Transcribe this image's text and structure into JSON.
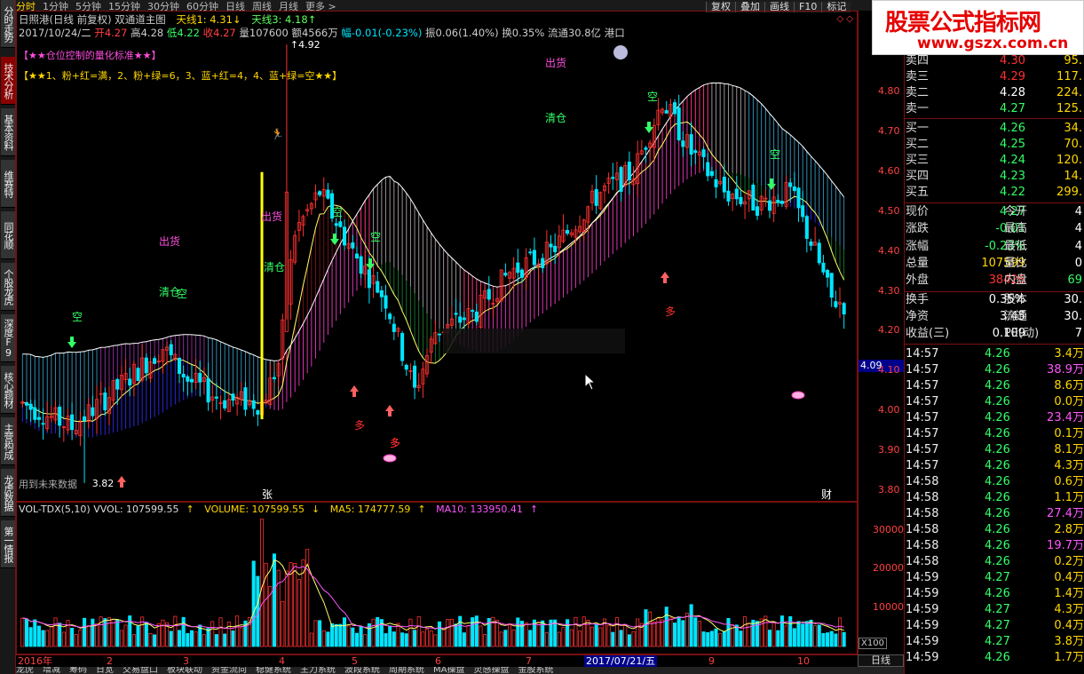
{
  "top_tabs": [
    "分时",
    "1分钟",
    "5分钟",
    "15分钟",
    "30分钟",
    "60分钟",
    "日线",
    "周线",
    "月线",
    "更多 >"
  ],
  "top_buttons": [
    "复权",
    "叠加",
    "画线",
    "F10",
    "标记"
  ],
  "left_tabs": [
    "分时走势",
    "技术分析",
    "基本资料",
    "维赛特10",
    "同花顺",
    "个股龙虎",
    "深度F9",
    "核心题材",
    "主营构成",
    "龙虎数据",
    "第一情报"
  ],
  "header": {
    "line1_title": "日照港(日线 前复权) 双通道主图",
    "line1_tian1": "天线1: 4.31",
    "line1_tian3": "天线3: 4.18",
    "line2_date": "2017/10/24/二",
    "line2_open": "开4.27",
    "line2_high": "高4.28",
    "line2_low": "低4.22",
    "line2_close": "收4.27",
    "line2_vol": "量107600",
    "line2_amt": "额4566万",
    "line2_chg": "幅-0.01(-0.23%)",
    "line2_amp": "振0.06(1.40%)",
    "line2_turn": "换0.35%",
    "line2_float": "流通30.8亿",
    "line2_market": "港口",
    "line3": "【★★仓位控制的量化标准★★】",
    "line4": "【★★1、粉+红=满，2、粉+绿=6，3、蓝+红=4，4、蓝+绿=空★★】"
  },
  "price_axis": [
    "4.80",
    "4.70",
    "4.60",
    "4.50",
    "4.40",
    "4.30",
    "4.20",
    "4.10",
    "4.00",
    "3.90",
    "3.80"
  ],
  "current_price_tag": "4.09",
  "chart_annotations": {
    "high_label": "4.92",
    "low_label": "3.82",
    "future_note": "用到未来数据",
    "signals": [
      "空",
      "出货",
      "清仓",
      "空",
      "出货",
      "清仓",
      "空",
      "空",
      "多",
      "多",
      "多",
      "出货",
      "清仓",
      "空",
      "空",
      "多",
      "张",
      "财"
    ]
  },
  "volume": {
    "header_name": "VOL-TDX(5,10)",
    "vvol": "VVOL: 107599.55",
    "volume": "VOLUME: 107599.55",
    "ma5": "MA5: 174777.59",
    "ma10": "MA10: 133950.41",
    "axis": [
      "30000",
      "20000",
      "10000"
    ],
    "scale": "X100"
  },
  "date_axis": {
    "labels": [
      "2016年",
      "2",
      "3",
      "4",
      "5",
      "6",
      "7",
      "9",
      "10"
    ],
    "selected_date": "2017/07/21/五",
    "period_button": "日线"
  },
  "bottom_tabs": [
    "龙虎",
    "增减",
    "筹码",
    "日宽",
    "交易盘口",
    "板块联动",
    "资金流向",
    "稳健系统",
    "主力系统",
    "波段系统",
    "周期系统",
    "MA操盘",
    "灵感操盘",
    "金股系统"
  ],
  "logo": {
    "title": "股票公式指标网",
    "url": "www.gszx.com.cn"
  },
  "orderbook": {
    "sells": [
      {
        "label": "卖四",
        "price": "4.30",
        "vol": "95."
      },
      {
        "label": "卖三",
        "price": "4.29",
        "vol": "117."
      },
      {
        "label": "卖二",
        "price": "4.28",
        "vol": "224."
      },
      {
        "label": "卖一",
        "price": "4.27",
        "vol": "125."
      }
    ],
    "buys": [
      {
        "label": "买一",
        "price": "4.26",
        "vol": "34."
      },
      {
        "label": "买二",
        "price": "4.25",
        "vol": "70."
      },
      {
        "label": "买三",
        "price": "4.24",
        "vol": "120."
      },
      {
        "label": "买四",
        "price": "4.23",
        "vol": "14."
      },
      {
        "label": "买五",
        "price": "4.22",
        "vol": "299."
      }
    ]
  },
  "quote": [
    {
      "k1": "现价",
      "v1": "4.27",
      "k2": "今开",
      "v2": "4"
    },
    {
      "k1": "涨跌",
      "v1": "-0.01",
      "k2": "最高",
      "v2": "4"
    },
    {
      "k1": "涨幅",
      "v1": "-0.23%",
      "k2": "最低",
      "v2": "4"
    },
    {
      "k1": "总量",
      "v1": "107599",
      "k2": "量比",
      "v2": "0"
    },
    {
      "k1": "外盘",
      "v1": "38426",
      "k2": "内盘",
      "v2": "69"
    },
    {
      "k1": "换手",
      "v1": "0.35%",
      "k2": "股本",
      "v2": "30."
    },
    {
      "k1": "净资",
      "v1": "3.45",
      "k2": "流通",
      "v2": "30."
    },
    {
      "k1": "收益(三)",
      "v1": "0.109",
      "k2": "PE(动)",
      "v2": "7"
    }
  ],
  "ticks": [
    {
      "t": "14:57",
      "p": "4.26",
      "v": "3.4万"
    },
    {
      "t": "14:57",
      "p": "4.26",
      "v": "38.9万"
    },
    {
      "t": "14:57",
      "p": "4.26",
      "v": "8.6万"
    },
    {
      "t": "14:57",
      "p": "4.26",
      "v": "0.0万"
    },
    {
      "t": "14:57",
      "p": "4.26",
      "v": "23.4万"
    },
    {
      "t": "14:57",
      "p": "4.26",
      "v": "0.1万"
    },
    {
      "t": "14:57",
      "p": "4.26",
      "v": "8.1万"
    },
    {
      "t": "14:57",
      "p": "4.26",
      "v": "4.3万"
    },
    {
      "t": "14:58",
      "p": "4.26",
      "v": "0.6万"
    },
    {
      "t": "14:58",
      "p": "4.26",
      "v": "1.1万"
    },
    {
      "t": "14:58",
      "p": "4.26",
      "v": "27.4万"
    },
    {
      "t": "14:58",
      "p": "4.26",
      "v": "2.8万"
    },
    {
      "t": "14:58",
      "p": "4.26",
      "v": "19.7万"
    },
    {
      "t": "14:58",
      "p": "4.26",
      "v": "0.2万"
    },
    {
      "t": "14:59",
      "p": "4.27",
      "v": "0.4万"
    },
    {
      "t": "14:59",
      "p": "4.26",
      "v": "1.4万"
    },
    {
      "t": "14:59",
      "p": "4.27",
      "v": "4.3万"
    },
    {
      "t": "14:59",
      "p": "4.27",
      "v": "0.4万"
    },
    {
      "t": "14:59",
      "p": "4.27",
      "v": "3.8万"
    },
    {
      "t": "14:59",
      "p": "4.26",
      "v": "1.7万"
    }
  ],
  "colors": {
    "up": "#ff3030",
    "down": "#33ff66",
    "frame": "#7a1010",
    "axis": "#ff4040",
    "pink": "#ff4de0",
    "blue": "#2a2aff"
  }
}
